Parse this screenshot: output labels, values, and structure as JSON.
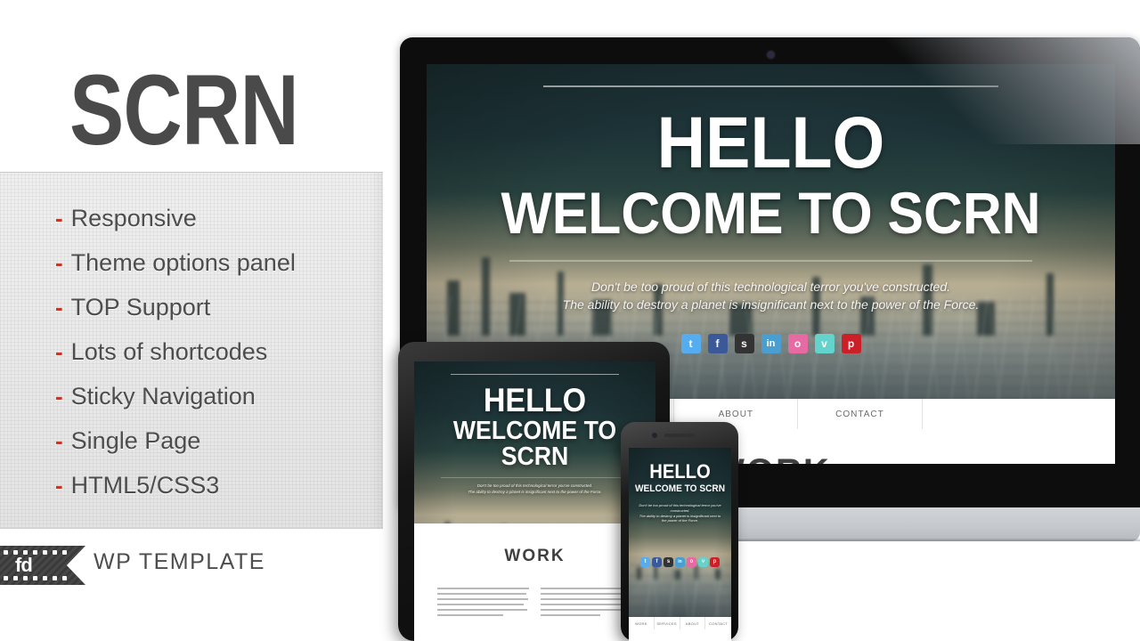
{
  "brand": {
    "title": "SCRN"
  },
  "features": {
    "bullet": "-",
    "items": [
      "Responsive",
      "Theme options panel",
      "TOP Support",
      "Lots of shortcodes",
      "Sticky Navigation",
      "Single Page",
      "HTML5/CSS3"
    ]
  },
  "footer": {
    "logo_text": "fd",
    "label": "WP TEMPLATE"
  },
  "preview": {
    "hero": {
      "line1": "HELLO",
      "line2": "WELCOME TO SCRN",
      "tagline_1": "Don't be too proud of this technological terror you've constructed.",
      "tagline_2": "The ability to destroy a planet is insignificant next to the power of the Force."
    },
    "social": [
      {
        "name": "twitter",
        "glyph": "t",
        "color": "#55acee"
      },
      {
        "name": "facebook",
        "glyph": "f",
        "color": "#3b5998"
      },
      {
        "name": "dribbble",
        "glyph": "s",
        "color": "#333333"
      },
      {
        "name": "linkedin",
        "glyph": "in",
        "color": "#4a9fd0"
      },
      {
        "name": "flickr",
        "glyph": "o",
        "color": "#e56ba2"
      },
      {
        "name": "vimeo",
        "glyph": "v",
        "color": "#63d3cc"
      },
      {
        "name": "pinterest",
        "glyph": "p",
        "color": "#cb2027"
      }
    ],
    "nav": [
      "WORK",
      "SERVICES",
      "ABOUT",
      "CONTACT"
    ],
    "section_title": "WORK"
  },
  "colors": {
    "accent_red": "#c0392b",
    "text_dark": "#4d4d4d",
    "panel_bg": "#eaeaea",
    "bezel": "#0d0d0d",
    "base_silver": "#c4c7cb"
  }
}
